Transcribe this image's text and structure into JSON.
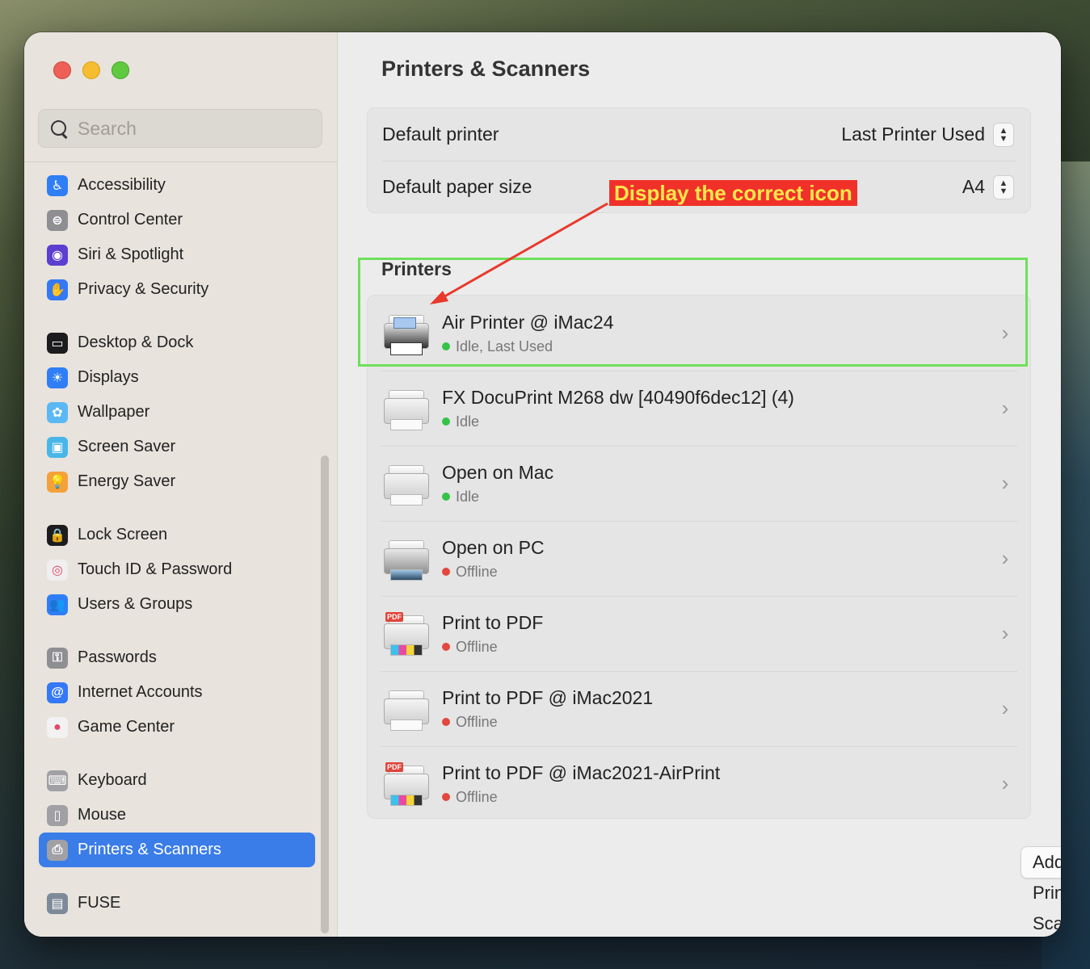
{
  "search": {
    "placeholder": "Search"
  },
  "sidebar": {
    "groups": [
      [
        {
          "label": "Accessibility",
          "icon": "accessibility-icon",
          "color": "#2f7ef6",
          "glyph": "♿"
        },
        {
          "label": "Control Center",
          "icon": "control-center-icon",
          "color": "#8e8e93",
          "glyph": "⊜"
        },
        {
          "label": "Siri & Spotlight",
          "icon": "siri-icon",
          "color": "#5b3fd1",
          "glyph": "◉"
        },
        {
          "label": "Privacy & Security",
          "icon": "hand-icon",
          "color": "#3478f6",
          "glyph": "✋"
        }
      ],
      [
        {
          "label": "Desktop & Dock",
          "icon": "dock-icon",
          "color": "#1c1c1e",
          "glyph": "▭"
        },
        {
          "label": "Displays",
          "icon": "sun-icon",
          "color": "#2f7ef6",
          "glyph": "☀"
        },
        {
          "label": "Wallpaper",
          "icon": "flower-icon",
          "color": "#5ab8f5",
          "glyph": "✿"
        },
        {
          "label": "Screen Saver",
          "icon": "screen-saver-icon",
          "color": "#49b6e8",
          "glyph": "▣"
        },
        {
          "label": "Energy Saver",
          "icon": "bulb-icon",
          "color": "#f4a13a",
          "glyph": "💡"
        }
      ],
      [
        {
          "label": "Lock Screen",
          "icon": "lock-icon",
          "color": "#1c1c1e",
          "glyph": "🔒"
        },
        {
          "label": "Touch ID & Password",
          "icon": "fingerprint-icon",
          "color": "#f0eeee",
          "glyph": "◎"
        },
        {
          "label": "Users & Groups",
          "icon": "users-icon",
          "color": "#2f7ef6",
          "glyph": "👥"
        }
      ],
      [
        {
          "label": "Passwords",
          "icon": "key-icon",
          "color": "#8e8e93",
          "glyph": "⚿"
        },
        {
          "label": "Internet Accounts",
          "icon": "at-icon",
          "color": "#3478f6",
          "glyph": "@"
        },
        {
          "label": "Game Center",
          "icon": "game-center-icon",
          "color": "#f2f2f2",
          "glyph": "●"
        }
      ],
      [
        {
          "label": "Keyboard",
          "icon": "keyboard-icon",
          "color": "#a0a0a5",
          "glyph": "⌨"
        },
        {
          "label": "Mouse",
          "icon": "mouse-icon",
          "color": "#a0a0a5",
          "glyph": "▯"
        },
        {
          "label": "Printers & Scanners",
          "icon": "printer-icon",
          "color": "#a0a0a5",
          "glyph": "⎙",
          "active": true
        }
      ],
      [
        {
          "label": "FUSE",
          "icon": "fuse-icon",
          "color": "#7d8a99",
          "glyph": "▤"
        }
      ]
    ]
  },
  "main": {
    "title": "Printers & Scanners",
    "defaults": {
      "printer_label": "Default printer",
      "printer_value": "Last Printer Used",
      "paper_label": "Default paper size",
      "paper_value": "A4"
    },
    "printers_heading": "Printers",
    "printers": [
      {
        "name": "Air Printer @ iMac24",
        "status": "Idle, Last Used",
        "state": "green",
        "kind": "air"
      },
      {
        "name": "FX DocuPrint M268 dw [40490f6dec12] (4)",
        "status": "Idle",
        "state": "green",
        "kind": "laser"
      },
      {
        "name": "Open on Mac",
        "status": "Idle",
        "state": "green",
        "kind": "generic"
      },
      {
        "name": "Open on PC",
        "status": "Offline",
        "state": "red",
        "kind": "dark"
      },
      {
        "name": "Print to PDF",
        "status": "Offline",
        "state": "red",
        "kind": "pdf"
      },
      {
        "name": "Print to PDF @ iMac2021",
        "status": "Offline",
        "state": "red",
        "kind": "generic"
      },
      {
        "name": "Print to PDF @ iMac2021-AirPrint",
        "status": "Offline",
        "state": "red",
        "kind": "pdf"
      }
    ],
    "add_button": "Add Printer, Scanner, or Fax...",
    "help_button": "?"
  },
  "annotation": {
    "callout_text": "Display the correct icon",
    "highlight_color": "#6fe05a",
    "callout_color": "#f0312a",
    "arrow_color": "#e8392c"
  }
}
